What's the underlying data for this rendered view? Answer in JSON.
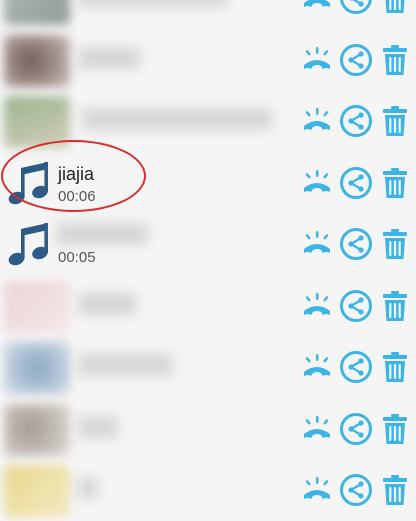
{
  "colors": {
    "accent": "#3db4e6",
    "highlight": "#d92c2c",
    "background": "#f5f5f5"
  },
  "icons": {
    "call": "hang-up-phone-icon",
    "share": "share-icon",
    "delete": "trash-icon",
    "media": "music-note-icon"
  },
  "rows": [
    {
      "type": "contact",
      "title": "",
      "duration": ""
    },
    {
      "type": "contact",
      "title": "",
      "duration": ""
    },
    {
      "type": "contact",
      "title": "",
      "duration": ""
    },
    {
      "type": "voice",
      "title": "jiajia",
      "duration": "00:06",
      "highlighted": true
    },
    {
      "type": "voice",
      "title": "",
      "duration": "00:05"
    },
    {
      "type": "contact",
      "title": "",
      "duration": ""
    },
    {
      "type": "contact",
      "title": "",
      "duration": ""
    },
    {
      "type": "contact",
      "title": "",
      "duration": ""
    },
    {
      "type": "contact",
      "title": "",
      "duration": ""
    }
  ]
}
